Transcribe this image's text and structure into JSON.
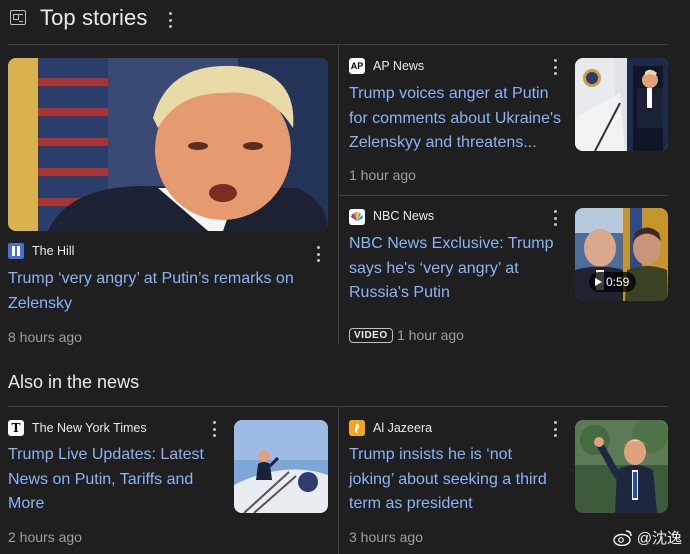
{
  "header": {
    "title": "Top stories",
    "icon": "newspaper-icon"
  },
  "top_stories": [
    {
      "publisher": "The Hill",
      "favicon": "the-hill-logo",
      "headline_lines": [
        "Trump ‘very angry’ at Putin’s remarks on",
        "Zelensky"
      ],
      "time": "8 hours ago"
    },
    {
      "publisher": "AP News",
      "favicon": "ap-news-logo",
      "favicon_text": "AP",
      "headline_lines": [
        "Trump voices anger at Putin",
        "for comments about Ukraine's",
        "Zelenskyy and threatens..."
      ],
      "time": "1 hour ago"
    },
    {
      "publisher": "NBC News",
      "favicon": "nbc-peacock-logo",
      "headline_lines": [
        "NBC News Exclusive: Trump",
        "says he's ‘very angry’ at",
        "Russia's Putin"
      ],
      "badge": "VIDEO",
      "time": "1 hour ago",
      "duration": "0:59"
    }
  ],
  "also_in_news": {
    "title": "Also in the news",
    "items": [
      {
        "publisher": "The New York Times",
        "favicon": "nyt-logo",
        "favicon_text": "T",
        "headline_lines": [
          "Trump Live Updates: Latest",
          "News on Putin, Tariffs and",
          "More"
        ],
        "time": "2 hours ago"
      },
      {
        "publisher": "Al Jazeera",
        "favicon": "al-jazeera-logo",
        "headline_lines": [
          "Trump insists he is ‘not",
          "joking’ about seeking a third",
          "term as president"
        ],
        "time": "3 hours ago"
      }
    ]
  },
  "watermark": {
    "text": "@沈逸",
    "icon": "weibo-icon"
  },
  "colors": {
    "background": "#1f1f1f",
    "link": "#8ab4f8",
    "meta": "#9aa0a6",
    "divider": "#3c4043"
  }
}
